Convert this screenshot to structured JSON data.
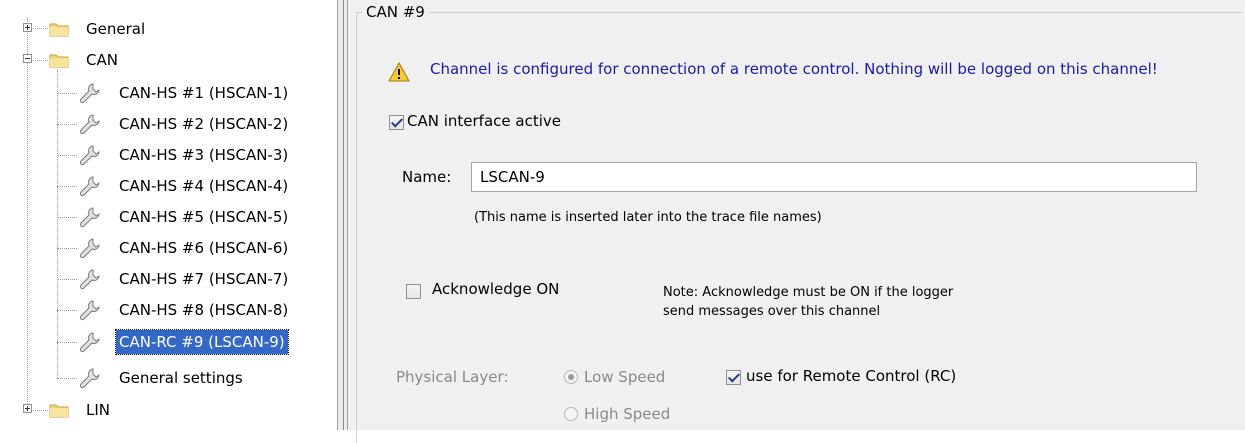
{
  "tree": {
    "general": "General",
    "can": "CAN",
    "channels": [
      "CAN-HS #1 (HSCAN-1)",
      "CAN-HS #2 (HSCAN-2)",
      "CAN-HS #3 (HSCAN-3)",
      "CAN-HS #4 (HSCAN-4)",
      "CAN-HS #5 (HSCAN-5)",
      "CAN-HS #6 (HSCAN-6)",
      "CAN-HS #7 (HSCAN-7)",
      "CAN-HS #8 (HSCAN-8)",
      "CAN-RC #9 (LSCAN-9)"
    ],
    "general_settings": "General settings",
    "lin": "LIN",
    "selected": "CAN-RC #9 (LSCAN-9)"
  },
  "panel": {
    "group_title": "CAN #9",
    "warning": "Channel is configured for connection of a remote control. Nothing will be logged on this channel!",
    "interface_active_label": "CAN interface active",
    "interface_active": true,
    "name_label": "Name:",
    "name_value": "LSCAN-9",
    "name_hint": "(This name is inserted later into the trace file names)",
    "acknowledge_label": "Acknowledge ON",
    "acknowledge": false,
    "ack_note_line1": "Note: Acknowledge must be ON if the logger",
    "ack_note_line2": "send messages over this channel",
    "physical_layer_label": "Physical Layer:",
    "low_speed_label": "Low Speed",
    "high_speed_label": "High Speed",
    "low_speed_selected": true,
    "remote_control_label": "use for Remote Control (RC)",
    "remote_control": true
  },
  "colors": {
    "selection": "#3368c6",
    "warning_text": "#1a1aa8",
    "panel_bg": "#f0f0f0"
  },
  "icons": {
    "folder": "folder-icon",
    "channel": "wrench-icon",
    "warning": "warning-icon"
  }
}
